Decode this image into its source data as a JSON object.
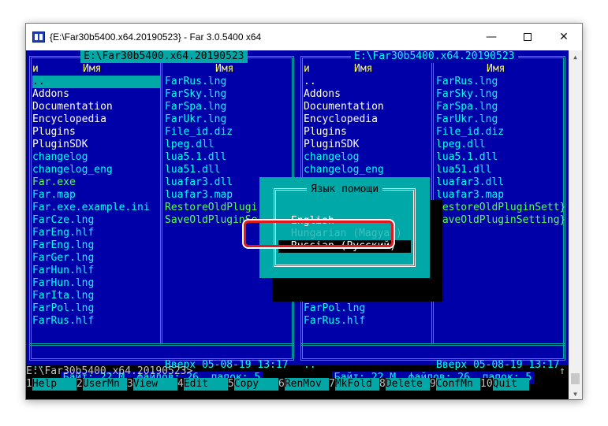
{
  "window": {
    "title": "{E:\\Far30b5400.x64.20190523} - Far 3.0.5400 x64",
    "minimize_glyph": "—",
    "close_glyph": "✕"
  },
  "left_panel": {
    "title": "E:\\Far30b5400.x64.20190523",
    "col_n": "и",
    "col_name": "Имя",
    "col1": [
      {
        "text": "..",
        "color": "cursor"
      },
      {
        "text": "Addons",
        "color": "white"
      },
      {
        "text": "Documentation",
        "color": "white"
      },
      {
        "text": "Encyclopedia",
        "color": "white"
      },
      {
        "text": "Plugins",
        "color": "white"
      },
      {
        "text": "PluginSDK",
        "color": "white"
      },
      {
        "text": "changelog",
        "color": "cyan"
      },
      {
        "text": "changelog_eng",
        "color": "cyan"
      },
      {
        "text": "Far.exe",
        "color": "green"
      },
      {
        "text": "Far.map",
        "color": "cyan"
      },
      {
        "text": "Far.exe.example.ini",
        "color": "cyan"
      },
      {
        "text": "FarCze.lng",
        "color": "cyan"
      },
      {
        "text": "FarEng.hlf",
        "color": "cyan"
      },
      {
        "text": "FarEng.lng",
        "color": "cyan"
      },
      {
        "text": "FarGer.lng",
        "color": "cyan"
      },
      {
        "text": "FarHun.hlf",
        "color": "cyan"
      },
      {
        "text": "FarHun.lng",
        "color": "cyan"
      },
      {
        "text": "FarIta.lng",
        "color": "cyan"
      },
      {
        "text": "FarPol.lng",
        "color": "cyan"
      },
      {
        "text": "FarRus.hlf",
        "color": "cyan"
      }
    ],
    "col2": [
      {
        "text": "FarRus.lng",
        "color": "cyan"
      },
      {
        "text": "FarSky.lng",
        "color": "cyan"
      },
      {
        "text": "FarSpa.lng",
        "color": "cyan"
      },
      {
        "text": "FarUkr.lng",
        "color": "cyan"
      },
      {
        "text": "File_id.diz",
        "color": "cyan"
      },
      {
        "text": "lpeg.dll",
        "color": "cyan"
      },
      {
        "text": "lua5.1.dll",
        "color": "cyan"
      },
      {
        "text": "lua51.dll",
        "color": "cyan"
      },
      {
        "text": "luafar3.dll",
        "color": "cyan"
      },
      {
        "text": "luafar3.map",
        "color": "cyan"
      },
      {
        "text": "RestoreOldPlugi",
        "color": "green"
      },
      {
        "text": "SaveOldPluginSe",
        "color": "green"
      }
    ],
    "status_name": "..",
    "status_info": "Вверх 05-08-19 13:17",
    "summary": "Байт: 22 М, файлов: 26, папок: 5"
  },
  "right_panel": {
    "title": "E:\\Far30b5400.x64.20190523",
    "col_n": "и",
    "col_name": "Имя",
    "col1": [
      {
        "text": "..",
        "color": "white"
      },
      {
        "text": "Addons",
        "color": "white"
      },
      {
        "text": "Documentation",
        "color": "white"
      },
      {
        "text": "Encyclopedia",
        "color": "white"
      },
      {
        "text": "Plugins",
        "color": "white"
      },
      {
        "text": "PluginSDK",
        "color": "white"
      },
      {
        "text": "changelog",
        "color": "cyan"
      },
      {
        "text": "changelog_eng",
        "color": "cyan"
      },
      {
        "text": "",
        "color": "cyan"
      },
      {
        "text": "",
        "color": "cyan"
      },
      {
        "text": "",
        "color": "cyan"
      },
      {
        "text": "",
        "color": "cyan"
      },
      {
        "text": "",
        "color": "cyan"
      },
      {
        "text": "",
        "color": "cyan"
      },
      {
        "text": "",
        "color": "cyan"
      },
      {
        "text": "FarHun.hlf",
        "color": "cyan"
      },
      {
        "text": "FarHun.lng",
        "color": "cyan"
      },
      {
        "text": "FarIta.lng",
        "color": "cyan"
      },
      {
        "text": "FarPol.lng",
        "color": "cyan"
      },
      {
        "text": "FarRus.hlf",
        "color": "cyan"
      }
    ],
    "col2": [
      {
        "text": "FarRus.lng",
        "color": "cyan"
      },
      {
        "text": "FarSky.lng",
        "color": "cyan"
      },
      {
        "text": "FarSpa.lng",
        "color": "cyan"
      },
      {
        "text": "FarUkr.lng",
        "color": "cyan"
      },
      {
        "text": "File_id.diz",
        "color": "cyan"
      },
      {
        "text": "lpeg.dll",
        "color": "cyan"
      },
      {
        "text": "lua5.1.dll",
        "color": "cyan"
      },
      {
        "text": "lua51.dll",
        "color": "cyan"
      },
      {
        "text": "luafar3.dll",
        "color": "cyan"
      },
      {
        "text": "luafar3.map",
        "color": "cyan"
      },
      {
        "text": "RestoreOldPluginSett}",
        "color": "green"
      },
      {
        "text": "SaveOldPluginSetting}",
        "color": "green"
      }
    ],
    "status_name": "..",
    "status_info": "Вверх 05-08-19 13:17",
    "summary": "Байт: 22 М, файлов: 26, папок: 5"
  },
  "dialog": {
    "title": "Язык помощи",
    "options": [
      "English",
      "Hungarian (Magyar)",
      "Russian (Русский)"
    ],
    "selected": "Russian (Русский)"
  },
  "command_line": {
    "prompt": "E:\\Far30b5400.x64.20190523>",
    "arrow": "↑"
  },
  "keybar": [
    {
      "num": "1",
      "label": "Help"
    },
    {
      "num": "2",
      "label": "UserMn"
    },
    {
      "num": "3",
      "label": "View"
    },
    {
      "num": "4",
      "label": "Edit"
    },
    {
      "num": "5",
      "label": "Copy"
    },
    {
      "num": "6",
      "label": "RenMov"
    },
    {
      "num": "7",
      "label": "MkFold"
    },
    {
      "num": "8",
      "label": "Delete"
    },
    {
      "num": "9",
      "label": "ConfMn"
    },
    {
      "num": "10",
      "label": "Quit"
    }
  ],
  "colors": {
    "panel_bg": "#0000a8",
    "cyan": "#00ffff",
    "frame": "#00a8a8",
    "highlight_ring": "#e3171e"
  }
}
